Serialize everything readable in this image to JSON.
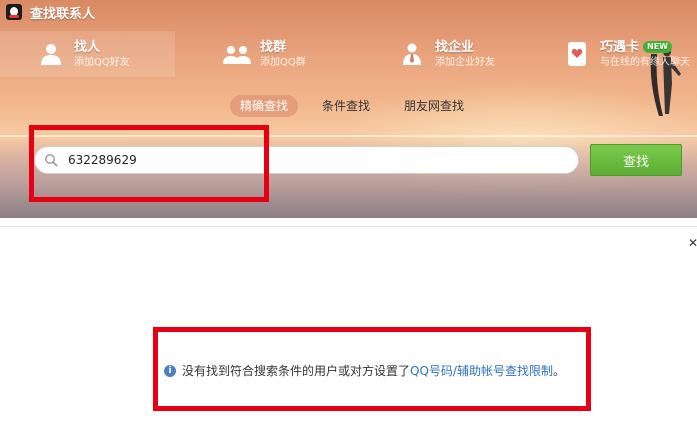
{
  "window": {
    "title": "查找联系人"
  },
  "nav": [
    {
      "label": "找人",
      "sub": "添加QQ好友",
      "icon": "person-icon"
    },
    {
      "label": "找群",
      "sub": "添加QQ群",
      "icon": "group-icon"
    },
    {
      "label": "找企业",
      "sub": "添加企业好友",
      "icon": "enterprise-icon"
    },
    {
      "label": "巧遇卡",
      "sub": "与在线的有缘人聊天",
      "badge": "NEW",
      "icon": "card-icon"
    }
  ],
  "subtabs": [
    "精确查找",
    "条件查找",
    "朋友网查找"
  ],
  "search": {
    "value": "632289629",
    "button_label": "查找"
  },
  "result": {
    "message": "没有找到符合搜索条件的用户或对方设置了",
    "link": "QQ号码/辅助帐号查找限制",
    "end": "。"
  },
  "colors": {
    "accent_green": "#5cae33",
    "highlight_red": "#e60012",
    "link_blue": "#2b73c2"
  }
}
